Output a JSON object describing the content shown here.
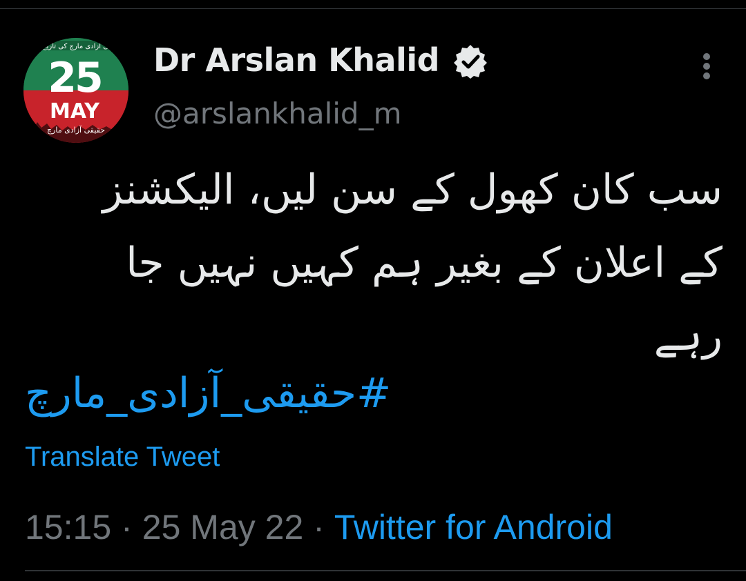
{
  "user": {
    "display_name": "Dr Arslan Khalid",
    "handle": "@arslankhalid_m",
    "verified": true,
    "avatar": {
      "date_number": "25",
      "date_month": "MAY",
      "banner_text": "حقیقی آزادی مارچ کی تاریخ",
      "footer_text": "حقیقی آزادی مارچ",
      "colors": {
        "top": "#1f8150",
        "bottom": "#c8232b"
      }
    }
  },
  "tweet": {
    "text_lines": [
      "سب کان کھول کے سن لیں، الیکشنز",
      "کے اعلان کے بغیر ہم کہیں نہیں جا",
      "رہے"
    ],
    "hashtag": "#حقیقی_آزادی_مارچ",
    "translate_label": "Translate Tweet"
  },
  "meta": {
    "time": "15:15",
    "separator": "·",
    "date": "25 May 22",
    "source": "Twitter for Android"
  },
  "icons": {
    "verified": "verified-badge-icon",
    "more": "more-vertical-icon"
  },
  "colors": {
    "background": "#000000",
    "text": "#e7e9ea",
    "muted": "#71767b",
    "link": "#1d9bf0"
  }
}
